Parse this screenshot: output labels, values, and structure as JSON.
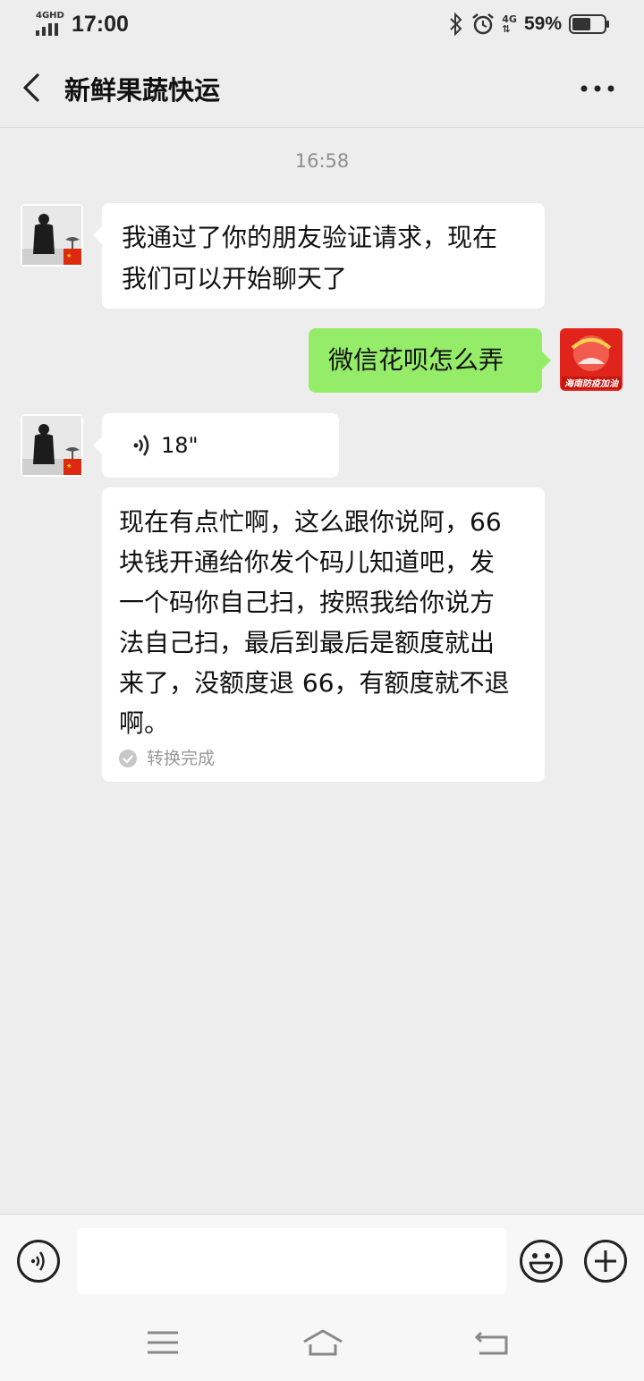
{
  "status_bar": {
    "network_type": "4GHD",
    "time": "17:00",
    "mobile_data": "4G",
    "battery_percent": "59%",
    "battery_level": 0.59
  },
  "header": {
    "title": "新鲜果蔬快运"
  },
  "chat": {
    "timestamp": "16:58",
    "messages": [
      {
        "sender": "contact",
        "type": "text",
        "text_lines": [
          "我通过了你的朋友验证请求，现在",
          "我们可以开始聊天了"
        ]
      },
      {
        "sender": "me",
        "type": "text",
        "text": "微信花呗怎么弄",
        "avatar_text": "海南防疫加油"
      },
      {
        "sender": "contact",
        "type": "voice",
        "duration": "18\"",
        "transcript_lines": [
          "现在有点忙啊，这么跟你说阿，66",
          "块钱开通给你发个码儿知道吧，发",
          "一个码你自己扫，按照我给你说方",
          "法自己扫，最后到最后是额度就出",
          "来了，没额度退 66，有额度就不退",
          "啊。"
        ],
        "transcript_status": "转换完成"
      }
    ]
  },
  "input_bar": {
    "value": "",
    "placeholder": ""
  },
  "colors": {
    "background": "#ededed",
    "bubble_me": "#95ec69",
    "bubble_contact": "#ffffff"
  }
}
